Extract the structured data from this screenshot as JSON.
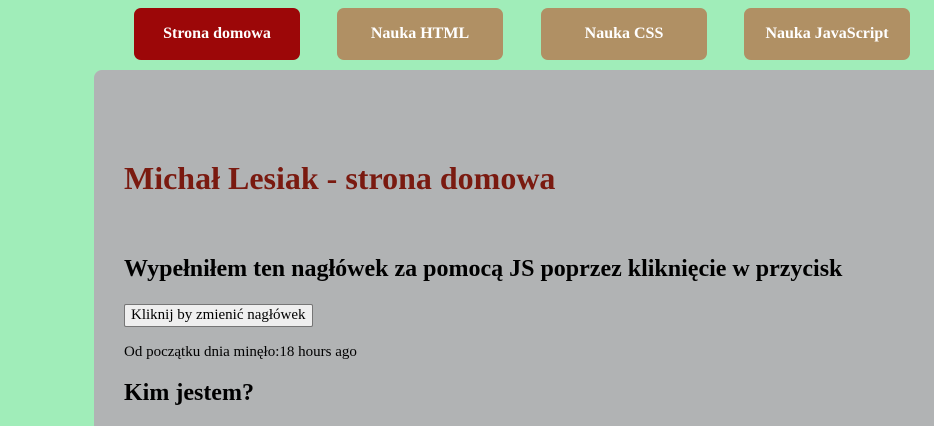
{
  "nav": {
    "items": [
      {
        "label": "Strona domowa",
        "active": true
      },
      {
        "label": "Nauka HTML",
        "active": false
      },
      {
        "label": "Nauka CSS",
        "active": false
      },
      {
        "label": "Nauka JavaScript",
        "active": false
      }
    ]
  },
  "main": {
    "title": "Michał Lesiak - strona domowa",
    "subheading": "Wypełniłem ten nagłówek za pomocą JS poprzez kliknięcie w przycisk",
    "change_button_label": "Kliknij by zmienić nagłówek",
    "elapsed_label": "Od początku dnia minęło:",
    "elapsed_value": "18 hours ago",
    "section_heading": "Kim jestem?"
  },
  "colors": {
    "page_background": "#a0edb9",
    "nav_active": "#9c0708",
    "nav_inactive": "#b09064",
    "content_background": "#b1b3b4",
    "title_color": "#7a1a10"
  }
}
